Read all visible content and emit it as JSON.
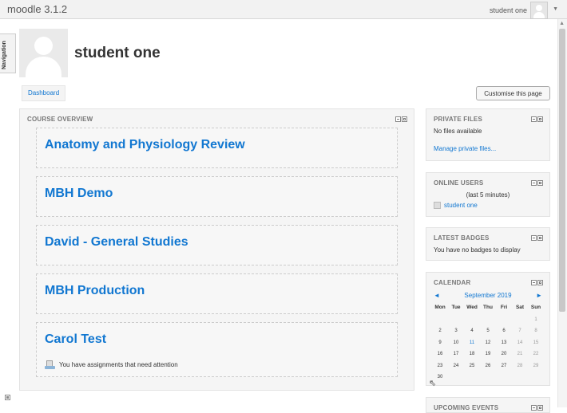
{
  "header": {
    "brand": "moodle 3.1.2",
    "user_name": "student one"
  },
  "nav_tab_label": "Navigation",
  "page": {
    "title": "student one",
    "breadcrumb": "Dashboard",
    "customise_button": "Customise this page"
  },
  "course_overview": {
    "title": "COURSE OVERVIEW",
    "courses": [
      {
        "name": "Anatomy and Physiology Review"
      },
      {
        "name": "MBH Demo"
      },
      {
        "name": "David - General Studies"
      },
      {
        "name": "MBH Production"
      },
      {
        "name": "Carol Test",
        "note": "You have assignments that need attention"
      }
    ]
  },
  "private_files": {
    "title": "PRIVATE FILES",
    "empty_text": "No files available",
    "manage_link": "Manage private files..."
  },
  "online_users": {
    "title": "ONLINE USERS",
    "period": "(last 5 minutes)",
    "users": [
      "student one"
    ]
  },
  "latest_badges": {
    "title": "LATEST BADGES",
    "text": "You have no badges to display"
  },
  "calendar": {
    "title": "CALENDAR",
    "prev": "◄",
    "next": "►",
    "month": "September 2019",
    "weekdays": [
      "Mon",
      "Tue",
      "Wed",
      "Thu",
      "Fri",
      "Sat",
      "Sun"
    ],
    "weeks": [
      [
        "",
        "",
        "",
        "",
        "",
        "",
        "1"
      ],
      [
        "2",
        "3",
        "4",
        "5",
        "6",
        "7",
        "8"
      ],
      [
        "9",
        "10",
        "11",
        "12",
        "13",
        "14",
        "15"
      ],
      [
        "16",
        "17",
        "18",
        "19",
        "20",
        "21",
        "22"
      ],
      [
        "23",
        "24",
        "25",
        "26",
        "27",
        "28",
        "29"
      ],
      [
        "30",
        "",
        "",
        "",
        "",
        "",
        ""
      ]
    ],
    "highlight_day": "11"
  },
  "upcoming_events": {
    "title": "UPCOMING EVENTS"
  },
  "colors": {
    "link": "#1177d1",
    "block_bg": "#f5f5f5",
    "title_grey": "#777777"
  }
}
